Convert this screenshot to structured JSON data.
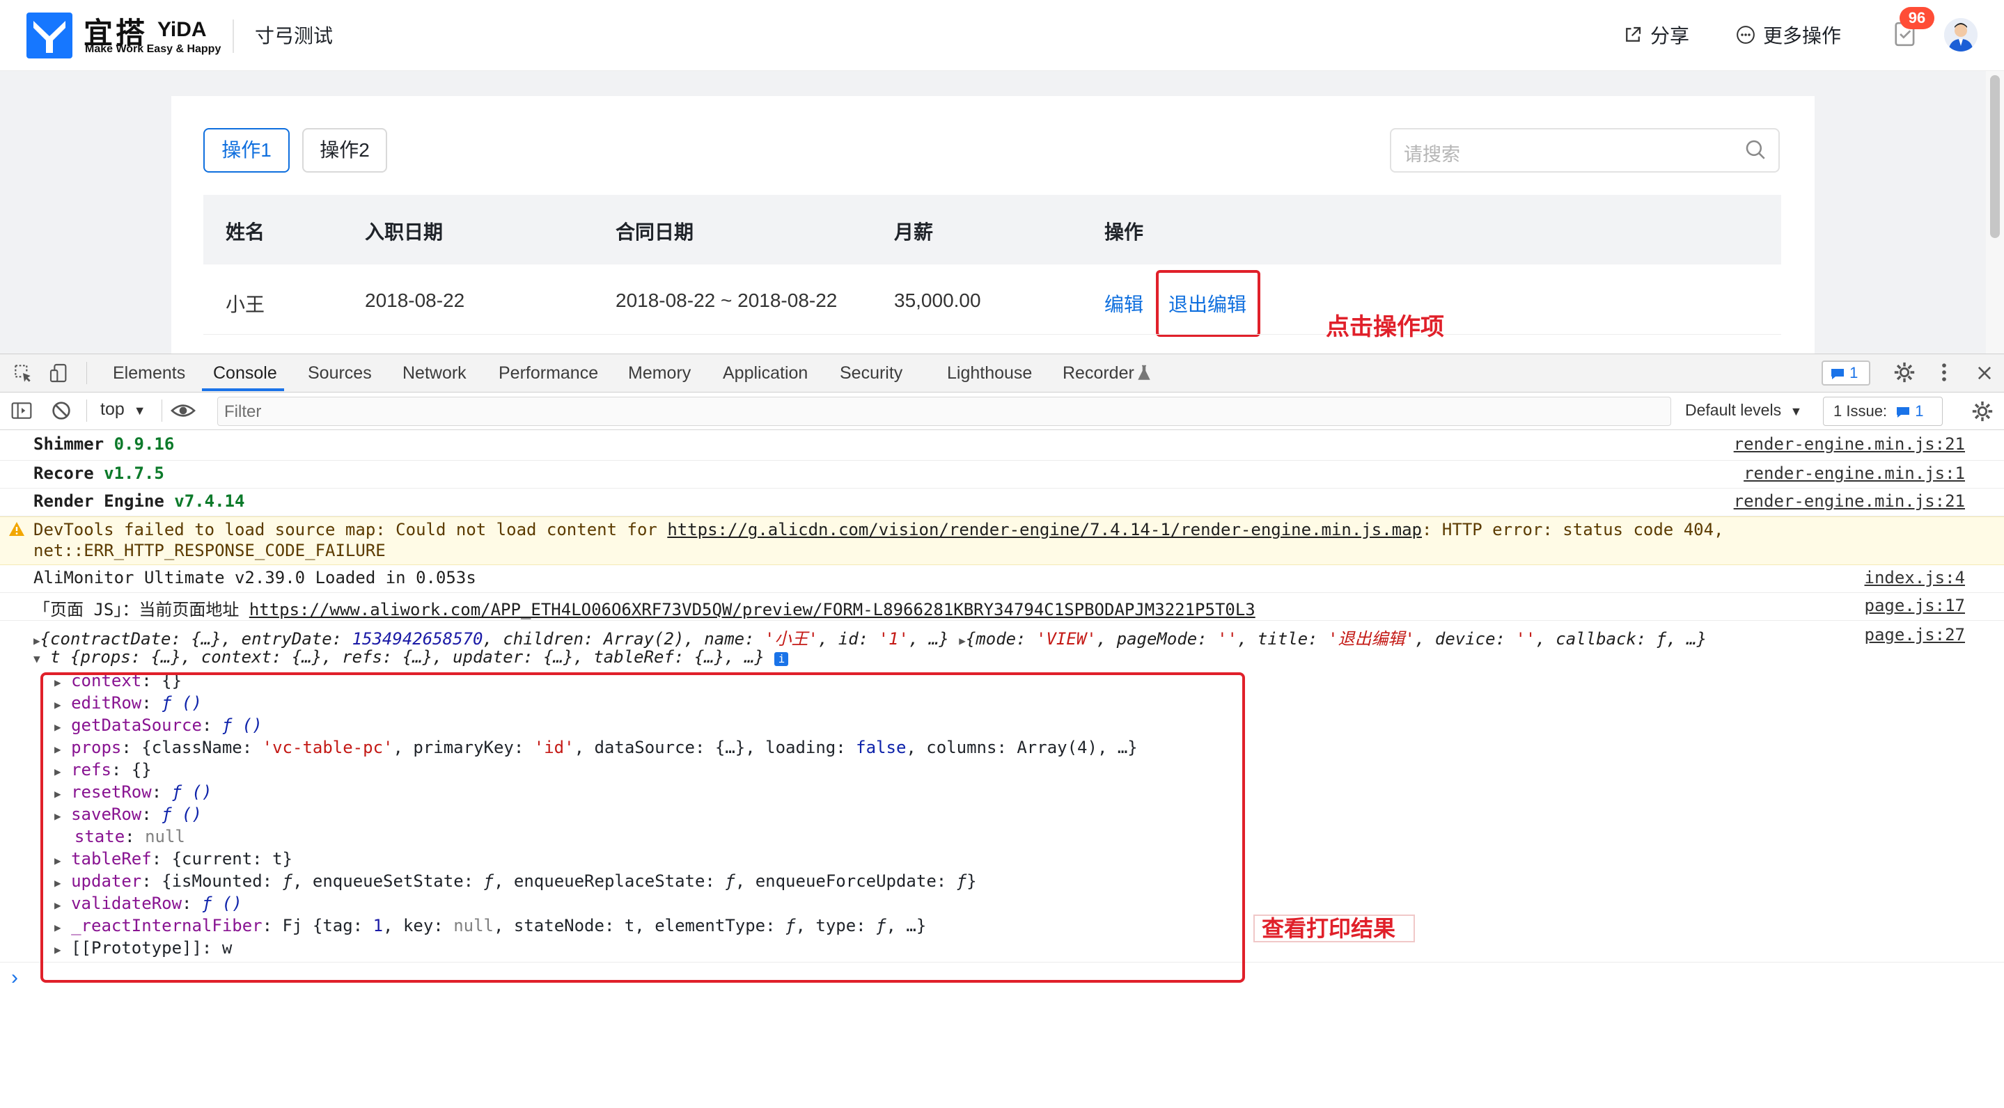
{
  "app": {
    "brand_cn": "宜搭",
    "brand_en": "YiDA",
    "slogan": "Make Work Easy & Happy",
    "title": "寸弓测试",
    "share_label": "分享",
    "more_label": "更多操作",
    "todo_badge": "96"
  },
  "page": {
    "tabs": [
      {
        "label": "操作1",
        "active": true
      },
      {
        "label": "操作2",
        "active": false
      }
    ],
    "search_placeholder": "请搜索",
    "columns": [
      "姓名",
      "入职日期",
      "合同日期",
      "月薪",
      "操作"
    ],
    "rows": [
      {
        "name": "小王",
        "entry_date": "2018-08-22",
        "contract": "2018-08-22 ~ 2018-08-22",
        "salary": "35,000.00",
        "edit": "编辑",
        "exit_edit": "退出编辑"
      }
    ],
    "annotation_click": "点击操作项"
  },
  "devtools": {
    "tabs": [
      "Elements",
      "Console",
      "Sources",
      "Network",
      "Performance",
      "Memory",
      "Application",
      "Security",
      "Lighthouse",
      "Recorder"
    ],
    "active_tab": "Console",
    "issues_chip": "1",
    "context": "top",
    "filter_placeholder": "Filter",
    "levels": "Default levels",
    "issues_button": "1 Issue:",
    "issues_count": "1",
    "logs": {
      "shimmer_name": "Shimmer",
      "shimmer_ver": "0.9.16",
      "shimmer_src": "render-engine.min.js:21",
      "recore_name": "Recore",
      "recore_ver": "v1.7.5",
      "recore_src": "render-engine.min.js:1",
      "re_name": "Render Engine",
      "re_ver": "v7.4.14",
      "re_src": "render-engine.min.js:21",
      "warn_prefix": "DevTools failed to load source map: Could not load content for",
      "warn_url": "https://g.alicdn.com/vision/render-engine/7.4.14-1/render-engine.min.js.map",
      "warn_suffix": ": HTTP error: status code 404,",
      "warn_line2": "net::ERR_HTTP_RESPONSE_CODE_FAILURE",
      "alimonitor": "AliMonitor Ultimate v2.39.0 Loaded in 0.053s",
      "alimonitor_src": "index.js:4",
      "page_prefix": "「页面 JS」：当前页面地址",
      "page_url": "https://www.aliwork.com/APP_ETH4LO06O6XRF73VD5QW/preview/FORM-L8966281KBRY34794C1SPBODAPJM3221P5T0L3",
      "page_src": "page.js:17",
      "obj_line_src": "page.js:27"
    },
    "object_line": {
      "entry_date": "1534942658570",
      "name": "'小王'",
      "id": "'1'",
      "mode": "'VIEW'",
      "page_mode": "''",
      "title": "'退出编辑'",
      "device": "''"
    },
    "expanded_summary": "t {props: {…}, context: {…}, refs: {…}, updater: {…}, tableRef: {…}, …}",
    "annotation_result": "查看打印结果",
    "prompt": "›"
  }
}
